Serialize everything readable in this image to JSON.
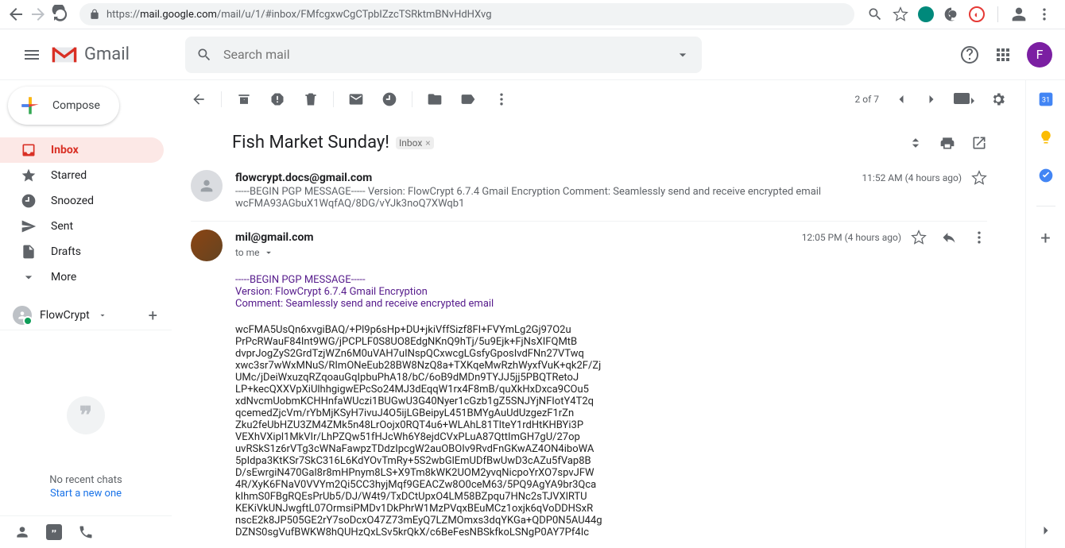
{
  "browser": {
    "url_prefix": "https://",
    "url_host": "mail.google.com",
    "url_path": "/mail/u/1/#inbox/FMfcgxwCgCTpbIZzcTSRktmBNvHdHXvg"
  },
  "header": {
    "brand": "Gmail",
    "search_placeholder": "Search mail",
    "avatar_initial": "F"
  },
  "compose": {
    "label": "Compose"
  },
  "nav": {
    "inbox": "Inbox",
    "starred": "Starred",
    "snoozed": "Snoozed",
    "sent": "Sent",
    "drafts": "Drafts",
    "more": "More"
  },
  "labels": {
    "flowcrypt": "FlowCrypt"
  },
  "hangouts": {
    "no_chats": "No recent chats",
    "start": "Start a new one"
  },
  "toolbar": {
    "counter": "2 of 7"
  },
  "subject": {
    "text": "Fish Market Sunday!",
    "chip": "Inbox",
    "chip_close": "×"
  },
  "msg1": {
    "sender": "flowcrypt.docs@gmail.com",
    "time": "11:52 AM (4 hours ago)",
    "snippet": "-----BEGIN PGP MESSAGE----- Version: FlowCrypt 6.7.4 Gmail Encryption Comment: Seamlessly send and receive encrypted email wcFMA93AGbuX1WqfAQ/8DG/vYJk3noQ7XWqb1"
  },
  "msg2": {
    "sender": "mil@gmail.com",
    "time": "12:05 PM (4 hours ago)",
    "to": "to me",
    "pgp_header": "-----BEGIN PGP MESSAGE-----",
    "pgp_version": "Version: FlowCrypt 6.7.4 Gmail Encryption",
    "pgp_comment": "Comment: Seamlessly send and receive encrypted email",
    "pgp_body": "wcFMA5UsQn6xvgiBAQ/+Pl9p6sHp+DU+jkiVffSizf8FI+FVYmLg2Gj97O2u\nPrPcRWauF84Int9WG/jPCPLF0S8UO8EdgNKnQ9hTj/5u9Ejk+FjNsXIFQMtB\ndvprJogZyS2GrdTzjWZn6M0uVAH7uINspQCxwcgLGsfyGposIvdFNn27VTwq\nxwc3sr7wWxMNuS/RImONeEub28BW8NzQ8a+TXKqeMwRzhWyxfVuK+qk2F/Zj\nUMc/jDeiWxuzqRZqoauGqIpbuPhA18/bC/6oB9dMDn9TYJJ5jj5PBQTRetoJ\nLP+kecQXXVpXiUlhhgigwEPcSo24MJ3dEqqW1rx4F8mB/quXkHxDxca9COu5\nxdNvcmUobmKCHHnfaWUczi1BUGwU3G40Nyer1cGzb1gZ5SNJYjNFIotY4T2q\nqcemedZjcVm/rYbMjKSyH7ivuJ4O5ijLGBeipyL451BMYgAuUdUzgezF1rZn\nZku2feUbHZU3ZM4ZMk5n48LrOojx0RQT4u6+WLAhL81TlteY1rdHtKHBYi3P\nVEXhVXipl1MkVIr/LhPZQw51fHJcWh6Y8ejdCVxPLuA87QttImGH7gU/27op\nuvRSkS1z6rVTg3cWNaFawpzTDdzIpcgW2auOBOIv9RvdFnGKwAZ4ON4iboWA\n5pIdpa3KtKSr7SkC316L6KdYOvTmRy+5S2wbGlEmUDfBwUwD3cAZu5fVap8B\nD/sEwrgiN470Gal8r8mHPnym8LS+X9Tm8kWK2UOM2yvqNicpoYrXO7spvJFW\n4R/XyK6FNaV0VVYm2Qi5CC3hyjMqf9GEACZw8O0ceM63/5PQ9AgYA9br3Qca\nkIhmS0FBgRQEsPrUb5/DJ/W4t9/TxDCtUpxO4LM58BZpqu7HNc2sTJVXlRTU\nKEKiVkUNJwgftL07OrmsiPMDv1DkPhrW1MzPVqxBEuMCz1oxjk6qVoDDHSxR\nnscE2k8JP505GE2rY7soDcxO47Z73mEyQ7LZMOmxs3dqYKGa+QDP0N5AU44g\nDZNS0sgVufBWKW8hQUHzQxLSv5krQkX/c6BeFesNBSkfkoLSNgP0AY7Pf4Ic"
  }
}
